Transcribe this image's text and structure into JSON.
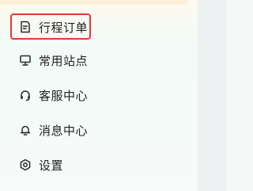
{
  "menu": {
    "items": [
      {
        "label": "行程订单",
        "icon": "document-icon"
      },
      {
        "label": "常用站点",
        "icon": "monitor-icon"
      },
      {
        "label": "客服中心",
        "icon": "headset-icon"
      },
      {
        "label": "消息中心",
        "icon": "bell-icon"
      },
      {
        "label": "设置",
        "icon": "gear-icon"
      }
    ],
    "selected_index": 0
  },
  "colors": {
    "highlight_border": "#e53935",
    "text": "#222222",
    "icon": "#2b2b2b"
  }
}
